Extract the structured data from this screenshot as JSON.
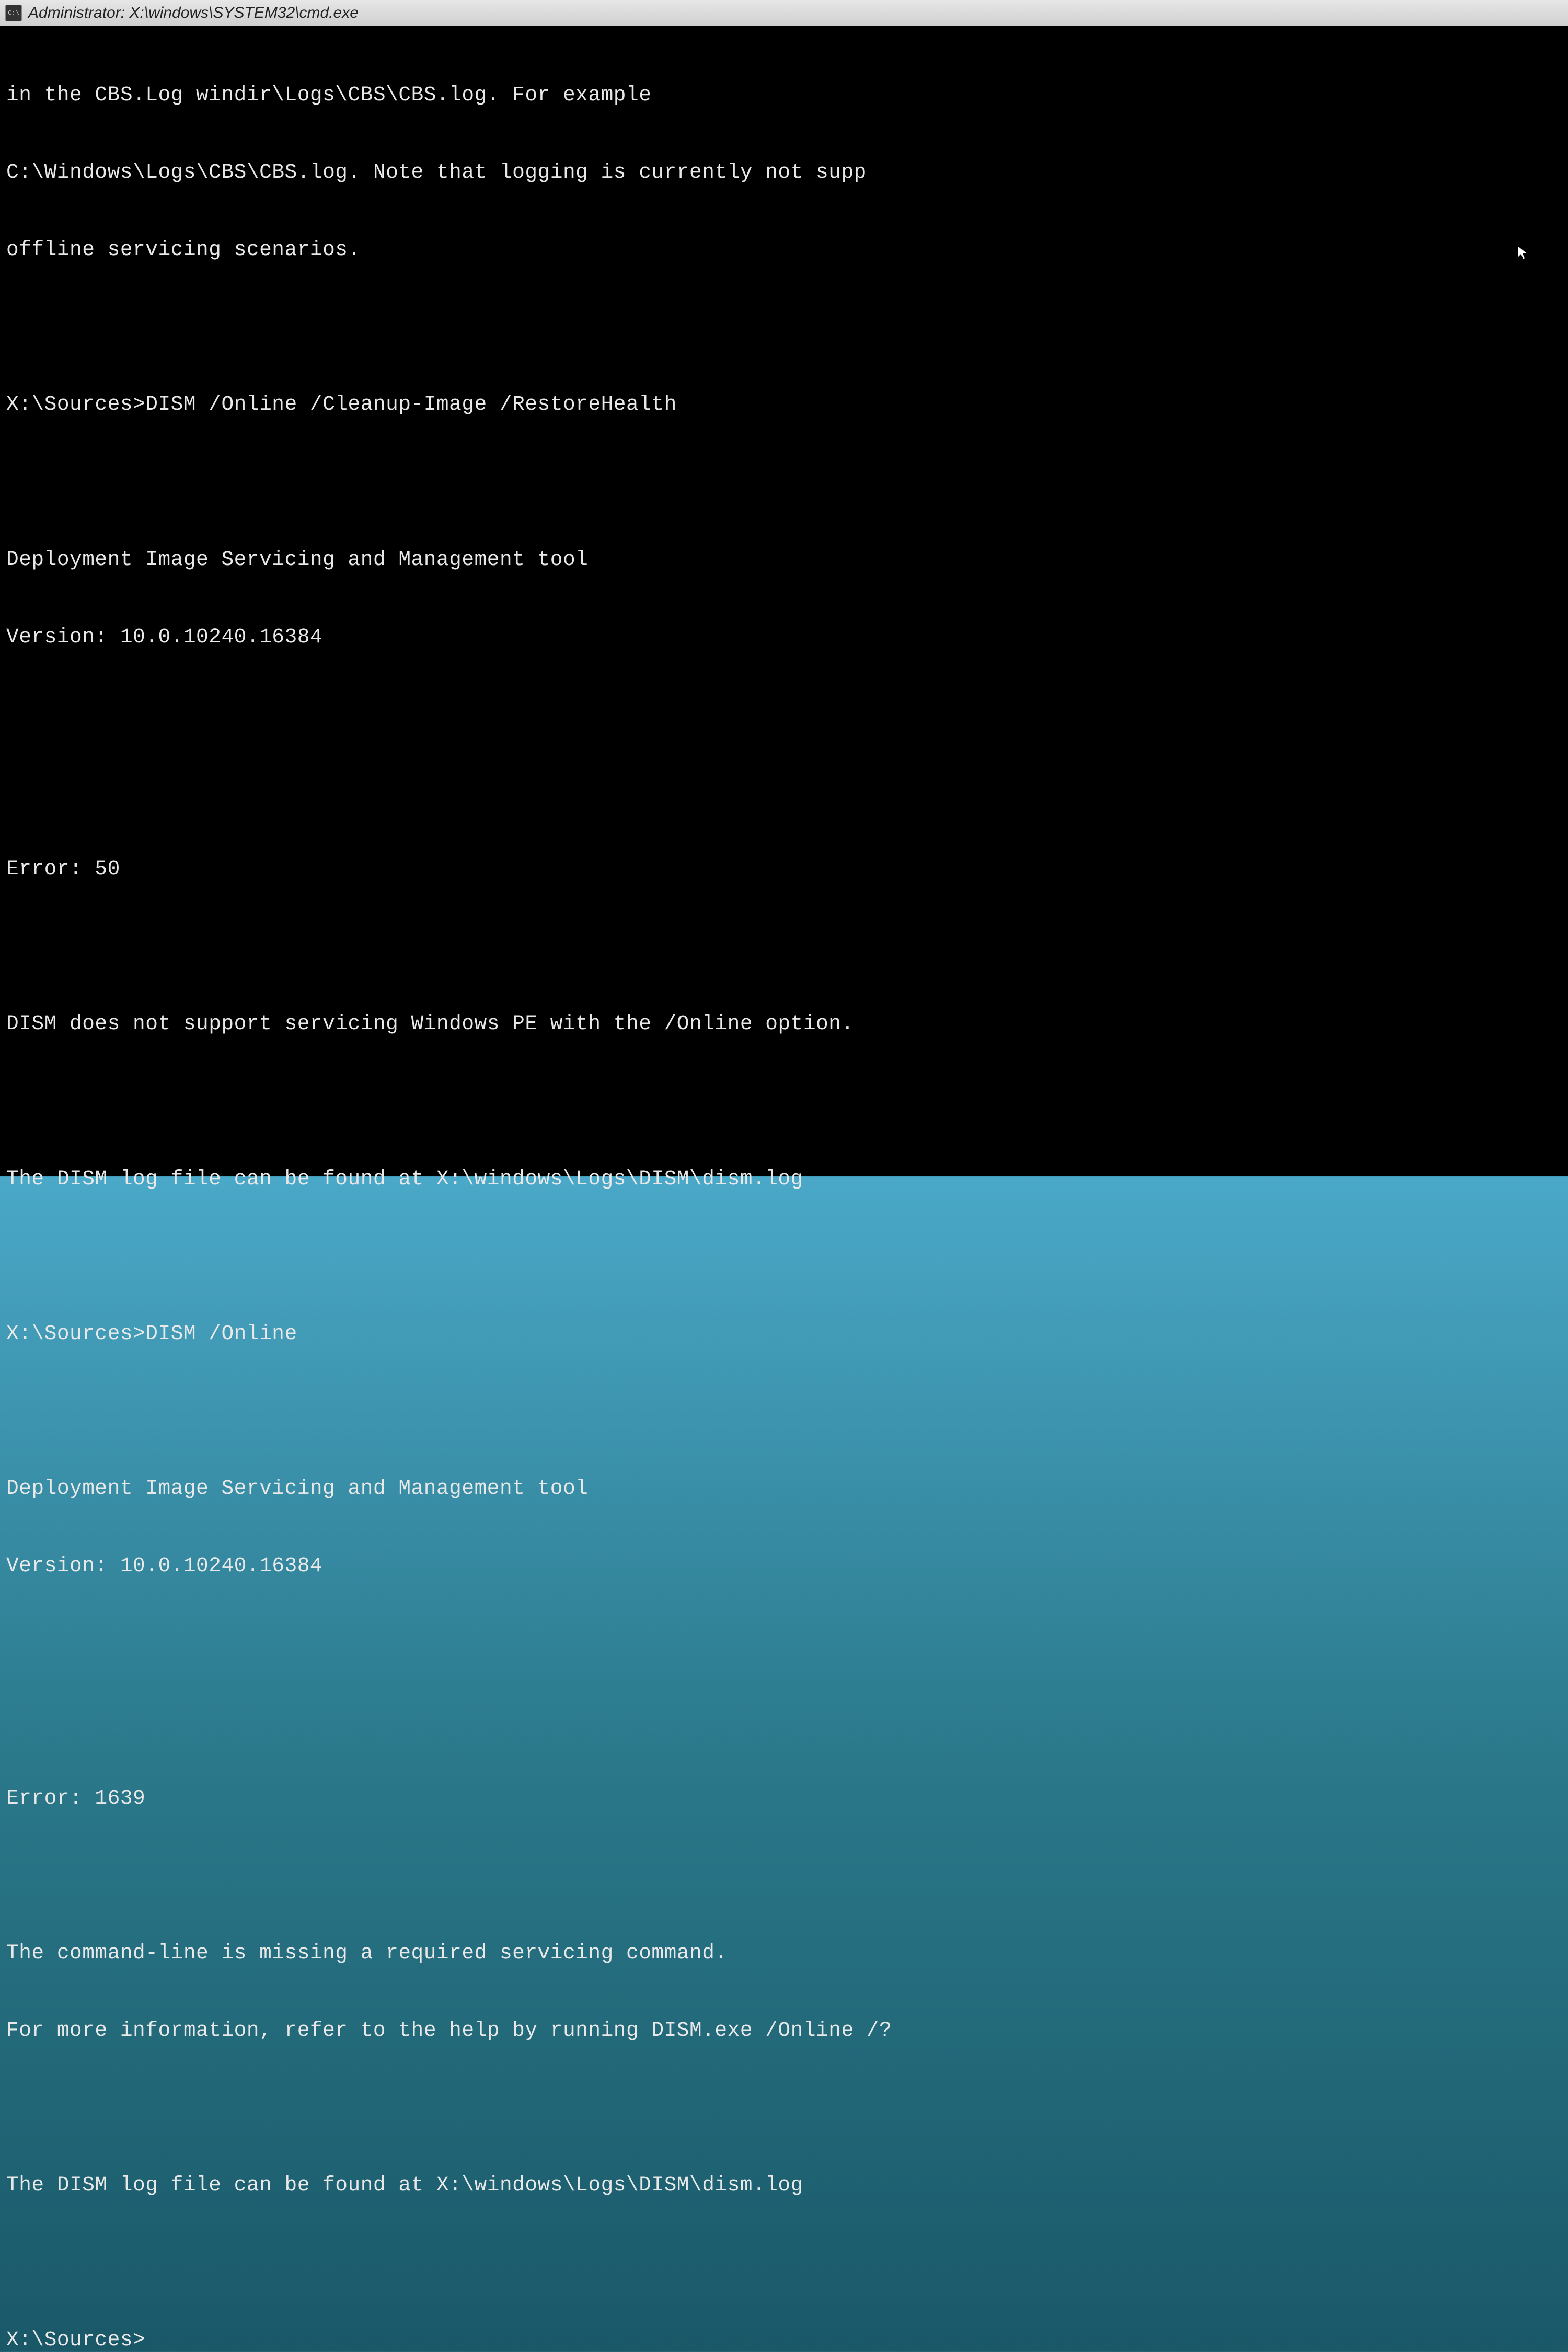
{
  "window": {
    "title": "Administrator: X:\\windows\\SYSTEM32\\cmd.exe"
  },
  "terminal": {
    "lines": [
      "in the CBS.Log windir\\Logs\\CBS\\CBS.log. For example",
      "C:\\Windows\\Logs\\CBS\\CBS.log. Note that logging is currently not supp",
      "offline servicing scenarios.",
      "",
      "X:\\Sources>DISM /Online /Cleanup-Image /RestoreHealth",
      "",
      "Deployment Image Servicing and Management tool",
      "Version: 10.0.10240.16384",
      "",
      "",
      "Error: 50",
      "",
      "DISM does not support servicing Windows PE with the /Online option.",
      "",
      "The DISM log file can be found at X:\\windows\\Logs\\DISM\\dism.log",
      "",
      "X:\\Sources>DISM /Online",
      "",
      "Deployment Image Servicing and Management tool",
      "Version: 10.0.10240.16384",
      "",
      "",
      "Error: 1639",
      "",
      "The command-line is missing a required servicing command.",
      "For more information, refer to the help by running DISM.exe /Online /?",
      "",
      "The DISM log file can be found at X:\\windows\\Logs\\DISM\\dism.log",
      "",
      "X:\\Sources>"
    ],
    "prompt": "X:\\Sources>",
    "dism_tool_name": "Deployment Image Servicing and Management tool",
    "dism_version": "10.0.10240.16384",
    "error_50_code": "50",
    "error_50_msg": "DISM does not support servicing Windows PE with the /Online option.",
    "error_1639_code": "1639",
    "error_1639_msg": "The command-line is missing a required servicing command.",
    "log_path": "X:\\windows\\Logs\\DISM\\dism.log",
    "command_1": "DISM /Online /Cleanup-Image /RestoreHealth",
    "command_2": "DISM /Online"
  }
}
